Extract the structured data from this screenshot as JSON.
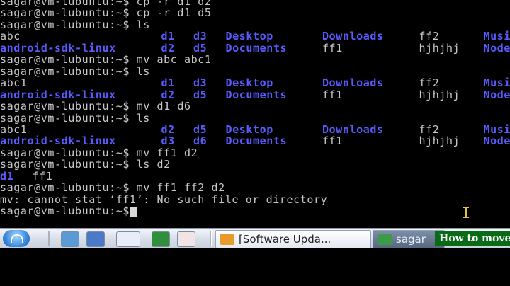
{
  "terminal": {
    "lines": [
      {
        "segments": [
          {
            "text": "sagar@vm-lubuntu:~$ cp -r d1 d2",
            "style": "plain",
            "col": 0
          }
        ]
      },
      {
        "segments": [
          {
            "text": "sagar@vm-lubuntu:~$ cp -r d1 d5",
            "style": "plain",
            "col": 0
          }
        ]
      },
      {
        "segments": [
          {
            "text": "sagar@vm-lubuntu:~$ ls",
            "style": "plain",
            "col": 0
          }
        ]
      },
      {
        "segments": [
          {
            "text": "abc",
            "style": "plain",
            "col": 0
          },
          {
            "text": "d1",
            "style": "dir",
            "col": 25
          },
          {
            "text": "d3",
            "style": "dir",
            "col": 30
          },
          {
            "text": "Desktop",
            "style": "dir",
            "col": 35
          },
          {
            "text": "Downloads",
            "style": "dir",
            "col": 50
          },
          {
            "text": "ff2",
            "style": "plain",
            "col": 65
          },
          {
            "text": "Musi",
            "style": "dir",
            "col": 75
          }
        ]
      },
      {
        "segments": [
          {
            "text": "android-sdk-linux",
            "style": "dir",
            "col": 0
          },
          {
            "text": "d2",
            "style": "dir",
            "col": 25
          },
          {
            "text": "d5",
            "style": "dir",
            "col": 30
          },
          {
            "text": "Documents",
            "style": "dir",
            "col": 35
          },
          {
            "text": "ff1",
            "style": "plain",
            "col": 50
          },
          {
            "text": "hjhjhj",
            "style": "plain",
            "col": 65
          },
          {
            "text": "Node",
            "style": "dir",
            "col": 75
          }
        ]
      },
      {
        "segments": [
          {
            "text": "sagar@vm-lubuntu:~$ mv abc abc1",
            "style": "plain",
            "col": 0
          }
        ]
      },
      {
        "segments": [
          {
            "text": "sagar@vm-lubuntu:~$ ls",
            "style": "plain",
            "col": 0
          }
        ]
      },
      {
        "segments": [
          {
            "text": "abc1",
            "style": "plain",
            "col": 0
          },
          {
            "text": "d1",
            "style": "dir",
            "col": 25
          },
          {
            "text": "d3",
            "style": "dir",
            "col": 30
          },
          {
            "text": "Desktop",
            "style": "dir",
            "col": 35
          },
          {
            "text": "Downloads",
            "style": "dir",
            "col": 50
          },
          {
            "text": "ff2",
            "style": "plain",
            "col": 65
          },
          {
            "text": "Musi",
            "style": "dir",
            "col": 75
          }
        ]
      },
      {
        "segments": [
          {
            "text": "android-sdk-linux",
            "style": "dir",
            "col": 0
          },
          {
            "text": "d2",
            "style": "dir",
            "col": 25
          },
          {
            "text": "d5",
            "style": "dir",
            "col": 30
          },
          {
            "text": "Documents",
            "style": "dir",
            "col": 35
          },
          {
            "text": "ff1",
            "style": "plain",
            "col": 50
          },
          {
            "text": "hjhjhj",
            "style": "plain",
            "col": 65
          },
          {
            "text": "Node",
            "style": "dir",
            "col": 75
          }
        ]
      },
      {
        "segments": [
          {
            "text": "sagar@vm-lubuntu:~$ mv d1 d6",
            "style": "plain",
            "col": 0
          }
        ]
      },
      {
        "segments": [
          {
            "text": "sagar@vm-lubuntu:~$ ls",
            "style": "plain",
            "col": 0
          }
        ]
      },
      {
        "segments": [
          {
            "text": "abc1",
            "style": "plain",
            "col": 0
          },
          {
            "text": "d2",
            "style": "dir",
            "col": 25
          },
          {
            "text": "d5",
            "style": "dir",
            "col": 30
          },
          {
            "text": "Desktop",
            "style": "dir",
            "col": 35
          },
          {
            "text": "Downloads",
            "style": "dir",
            "col": 50
          },
          {
            "text": "ff2",
            "style": "plain",
            "col": 65
          },
          {
            "text": "Musi",
            "style": "dir",
            "col": 75
          }
        ]
      },
      {
        "segments": [
          {
            "text": "android-sdk-linux",
            "style": "dir",
            "col": 0
          },
          {
            "text": "d3",
            "style": "dir",
            "col": 25
          },
          {
            "text": "d6",
            "style": "dir",
            "col": 30
          },
          {
            "text": "Documents",
            "style": "dir",
            "col": 35
          },
          {
            "text": "ff1",
            "style": "plain",
            "col": 50
          },
          {
            "text": "hjhjhj",
            "style": "plain",
            "col": 65
          },
          {
            "text": "Node",
            "style": "dir",
            "col": 75
          }
        ]
      },
      {
        "segments": [
          {
            "text": "sagar@vm-lubuntu:~$ mv ff1 d2",
            "style": "plain",
            "col": 0
          }
        ]
      },
      {
        "segments": [
          {
            "text": "sagar@vm-lubuntu:~$ ls d2",
            "style": "plain",
            "col": 0
          }
        ]
      },
      {
        "segments": [
          {
            "text": "d1",
            "style": "dir",
            "col": 0
          },
          {
            "text": "ff1",
            "style": "plain",
            "col": 5
          }
        ]
      },
      {
        "segments": [
          {
            "text": "sagar@vm-lubuntu:~$ mv ff1 ff2 d2",
            "style": "plain",
            "col": 0
          }
        ]
      },
      {
        "segments": [
          {
            "text": "mv: cannot stat ‘ff1’: No such file or directory",
            "style": "plain",
            "col": 0
          }
        ]
      },
      {
        "segments": [
          {
            "text": "sagar@vm-lubuntu:~$ ",
            "style": "plain",
            "col": 0
          }
        ],
        "cursor": true
      }
    ]
  },
  "taskbar": {
    "icons": [
      {
        "name": "file-manager-icon",
        "color": "#5b9bd5"
      },
      {
        "name": "show-desktop-icon",
        "color": "#4a79c8"
      },
      {
        "name": "browser-icon",
        "color": "#e8eef8"
      },
      {
        "name": "terminal-icon",
        "color": "#2f8f3a"
      },
      {
        "name": "blank-app-icon",
        "color": "#f0e4e4"
      }
    ],
    "tasks": [
      {
        "label": "[Software Upda...",
        "icon": "software-updater-icon",
        "icon_color": "#e79b2b"
      },
      {
        "label": "sagar",
        "icon": "terminal-icon",
        "icon_color": "#3d9a48"
      }
    ]
  },
  "caption": {
    "text": "How to move"
  },
  "colors": {
    "background": "#000000",
    "text": "#c8c8c8",
    "directory": "#5a5aff",
    "caption_bg": "#0a6b17"
  }
}
